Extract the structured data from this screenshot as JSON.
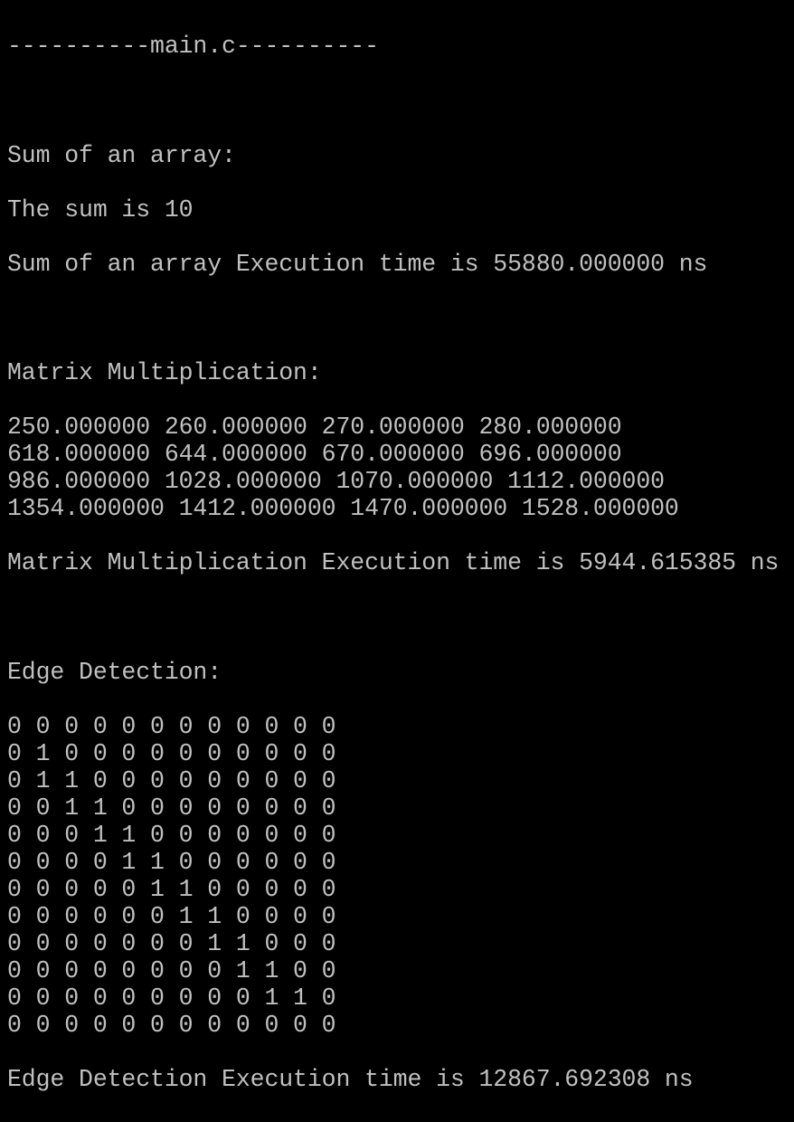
{
  "terminal": {
    "text_color": "#c0c0c0",
    "background_color": "#000000",
    "lines": [
      "----------main.c----------",
      "Sum of an array:",
      "The sum is 10",
      "Sum of an array Execution time is 55880.000000 ns",
      "Matrix Multiplication:",
      "250.000000 260.000000 270.000000 280.000000",
      "618.000000 644.000000 670.000000 696.000000",
      "986.000000 1028.000000 1070.000000 1112.000000",
      "1354.000000 1412.000000 1470.000000 1528.000000",
      "Matrix Multiplication Execution time is 5944.615385 ns",
      "Edge Detection:",
      "0 0 0 0 0 0 0 0 0 0 0 0",
      "0 1 0 0 0 0 0 0 0 0 0 0",
      "0 1 1 0 0 0 0 0 0 0 0 0",
      "0 0 1 1 0 0 0 0 0 0 0 0",
      "0 0 0 1 1 0 0 0 0 0 0 0",
      "0 0 0 0 1 1 0 0 0 0 0 0",
      "0 0 0 0 0 1 1 0 0 0 0 0",
      "0 0 0 0 0 0 1 1 0 0 0 0",
      "0 0 0 0 0 0 0 1 1 0 0 0",
      "0 0 0 0 0 0 0 0 1 1 0 0",
      "0 0 0 0 0 0 0 0 0 1 1 0",
      "0 0 0 0 0 0 0 0 0 0 0 0",
      "Edge Detection Execution time is 12867.692308 ns"
    ]
  }
}
